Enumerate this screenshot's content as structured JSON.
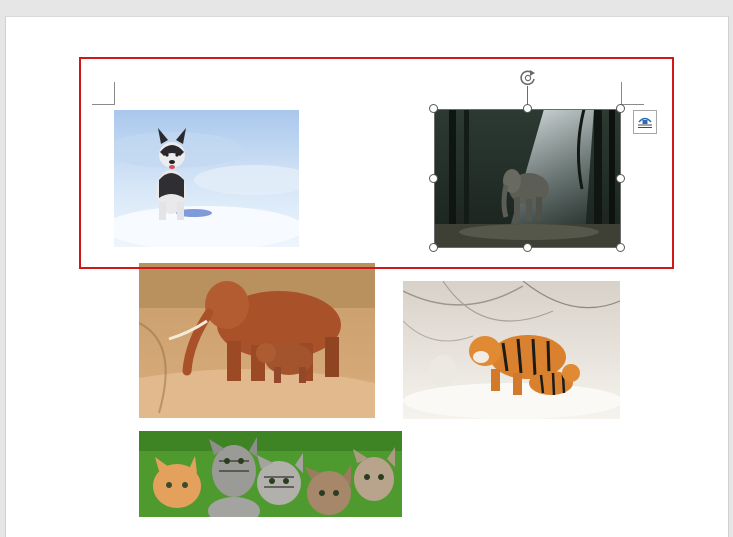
{
  "document": {
    "images": [
      {
        "name": "husky-puppy-in-snow",
        "selected": false
      },
      {
        "name": "elephant-in-misty-forest",
        "selected": true
      },
      {
        "name": "elephants-on-dirt-road",
        "selected": false
      },
      {
        "name": "tigers-in-snow",
        "selected": false
      },
      {
        "name": "kittens-on-grass",
        "selected": false
      }
    ]
  },
  "selection": {
    "rotate_icon": "rotate-icon",
    "layout_options_icon": "layout-options-icon"
  },
  "annotation": {
    "highlight_color": "#d01818"
  },
  "colors": {
    "app_background": "#e6e6e6",
    "page_background": "#ffffff"
  }
}
